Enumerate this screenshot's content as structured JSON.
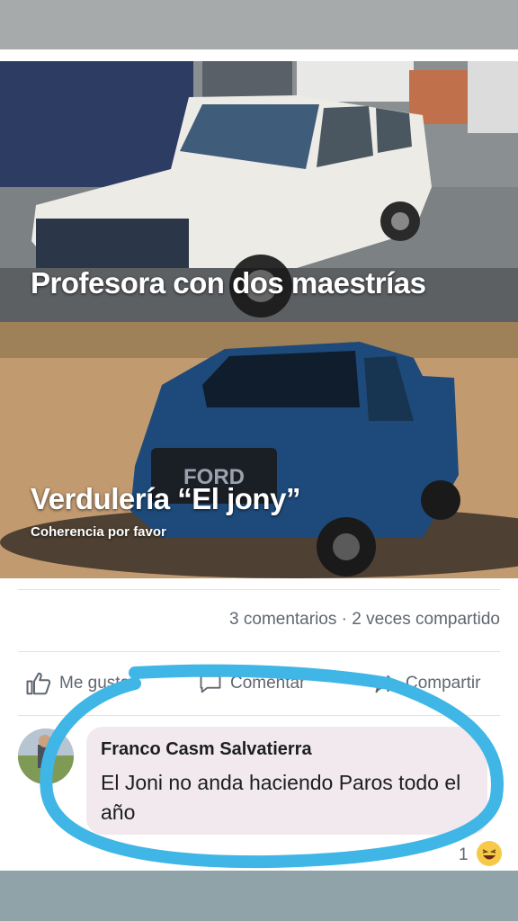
{
  "meme": {
    "top_caption": "Profesora con dos maestrías",
    "bottom_caption": "Verdulería “El jony”",
    "bottom_subcaption": "Coherencia por favor",
    "truck_badge": "FORD"
  },
  "post": {
    "stats": "3 comentarios · 2 veces compartido",
    "actions": {
      "like": "Me gusta",
      "comment": "Comentar",
      "share": "Compartir"
    }
  },
  "comment": {
    "author": "Franco Casm Salvatierra",
    "text": "El Joni no anda haciendo Paros todo el año",
    "reaction_count": "1"
  },
  "colors": {
    "highlight_circle": "#3fb6e6",
    "bubble_bg": "#f1e9ee",
    "meta_text": "#606770"
  }
}
